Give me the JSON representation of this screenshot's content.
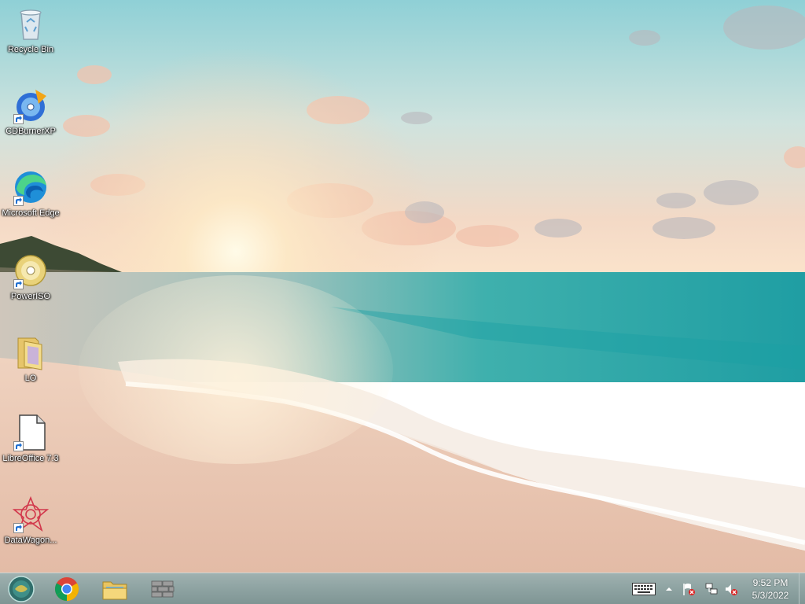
{
  "desktop": {
    "icons": [
      {
        "label": "Recycle Bin"
      },
      {
        "label": "CDBurnerXP"
      },
      {
        "label": "Microsoft Edge"
      },
      {
        "label": "PowerISO"
      },
      {
        "label": "LO"
      },
      {
        "label": "LibreOffice 7.3"
      },
      {
        "label": "DataWagon..."
      }
    ]
  },
  "taskbar": {
    "pinned": [
      "start-orb-icon",
      "chrome-icon",
      "file-explorer-icon",
      "firewall-icon"
    ],
    "tray": [
      "keyboard-icon",
      "chevron-up-icon",
      "flag-alert-icon",
      "network-icon",
      "volume-muted-icon"
    ],
    "clock": {
      "time": "9:52 PM",
      "date": "5/3/2022"
    }
  },
  "colors": {
    "taskbar": "#8ea3a2",
    "sky_top": "#8fd0d6",
    "sea": "#2aa9ad",
    "sand": "#e9c7b3"
  }
}
